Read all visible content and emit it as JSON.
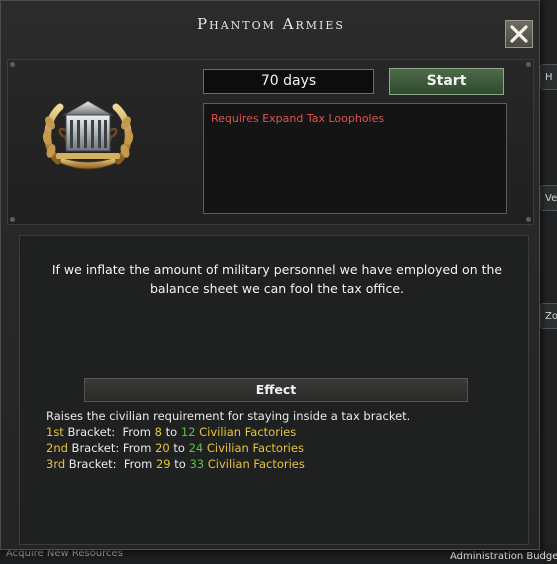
{
  "window": {
    "title": "Phantom Armies",
    "duration": "70 days",
    "start_label": "Start",
    "requirement": "Requires Expand Tax Loopholes",
    "description": "If we inflate the amount of military personnel we have employed on the balance sheet we can fool the tax office.",
    "effect_header": "Effect",
    "effect_intro": "Raises the civilian requirement for staying inside a tax bracket.",
    "brackets": [
      {
        "ordinal": "1st",
        "word": " Bracket:",
        "from_label": "  From ",
        "from": "8",
        "to_label": " to ",
        "to": "12",
        "unit": " Civilian Factories"
      },
      {
        "ordinal": "2nd",
        "word": " Bracket:",
        "from_label": " From ",
        "from": "20",
        "to_label": " to ",
        "to": "24",
        "unit": " Civilian Factories"
      },
      {
        "ordinal": "3rd",
        "word": " Bracket:",
        "from_label": "  From ",
        "from": "29",
        "to_label": " to ",
        "to": "33",
        "unit": " Civilian Factories"
      }
    ]
  },
  "background": {
    "chips": [
      "H",
      "Ve",
      "Zon"
    ],
    "bottom_left": "Acquire New Resources",
    "bottom_right": "Administration Budget"
  },
  "colors": {
    "accent_green": "#5fbf48",
    "highlight_yellow": "#e7c43b",
    "requirement_red": "#e0524a"
  }
}
